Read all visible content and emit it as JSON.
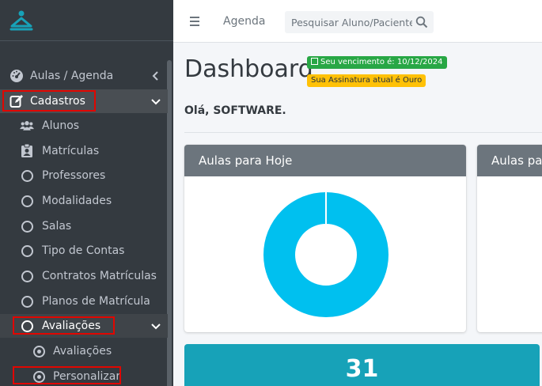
{
  "sidebar": {
    "items": [
      {
        "label": "Aulas / Agenda",
        "icon": "dashboard-gauge-icon"
      },
      {
        "label": "Cadastros",
        "icon": "edit-icon"
      },
      {
        "label": "Alunos",
        "icon": "users-icon"
      },
      {
        "label": "Matrículas",
        "icon": "id-badge-icon"
      },
      {
        "label": "Professores",
        "icon": "circle-icon"
      },
      {
        "label": "Modalidades",
        "icon": "circle-icon"
      },
      {
        "label": "Salas",
        "icon": "circle-icon"
      },
      {
        "label": "Tipo de Contas",
        "icon": "circle-icon"
      },
      {
        "label": "Contratos Matrículas",
        "icon": "circle-icon"
      },
      {
        "label": "Planos de Matrícula",
        "icon": "circle-icon"
      },
      {
        "label": "Avaliações",
        "icon": "circle-icon"
      },
      {
        "label": "Avaliações",
        "icon": "dot-circle-icon"
      },
      {
        "label": "Personalizar",
        "icon": "dot-circle-icon"
      }
    ]
  },
  "topbar": {
    "menu_icon": "hamburger-icon",
    "agenda_label": "Agenda",
    "search_placeholder": "Pesquisar Aluno/Paciente",
    "search_icon": "search-icon"
  },
  "page": {
    "title": "Dashboard",
    "badge_expiry": "Seu vencimento é: 10/12/2024",
    "badge_plan": "Sua Assinatura atual é Ouro",
    "greeting": "Olá, SOFTWARE."
  },
  "cards": [
    {
      "title": "Aulas para Hoje"
    },
    {
      "title": "Aulas para"
    }
  ],
  "stat": {
    "value": "31"
  },
  "chart_data": {
    "type": "pie",
    "title": "",
    "labels": [
      ""
    ],
    "values": [
      100
    ],
    "colors": [
      "#00c0ef"
    ]
  },
  "colors": {
    "sidebar_bg": "#343a40",
    "card_header": "#6c757d",
    "donut": "#00c0ef",
    "stat_box": "#17a2b8",
    "highlight": "#e10600"
  }
}
